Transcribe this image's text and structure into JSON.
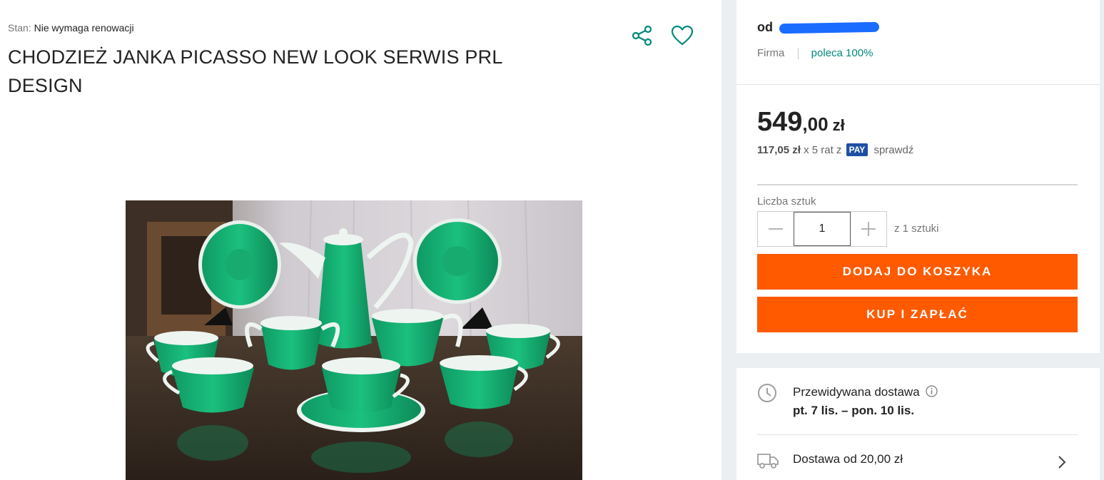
{
  "product": {
    "condition_label": "Stan:",
    "condition_value": "Nie wymaga renowacji",
    "title": "CHODZIEŻ JANKA PICASSO NEW LOOK SERWIS PRL DESIGN",
    "photo_alt": "green porcelain coffee set on table",
    "share_icon": "share-icon",
    "favorite_icon": "heart-icon"
  },
  "seller": {
    "prefix": "od",
    "type": "Firma",
    "recommend": "poleca 100%"
  },
  "pricing": {
    "price_int": "549",
    "price_dec": ",00",
    "currency": "zł",
    "installment_amount": "117,05 zł",
    "installment_text": "x 5 rat z",
    "pay_badge": "PAY",
    "check_link": "sprawdź"
  },
  "quantity": {
    "label": "Liczba sztuk",
    "value": "1",
    "of_text": "z 1 sztuki"
  },
  "actions": {
    "add_to_cart": "DODAJ DO KOSZYKA",
    "buy_now": "KUP I ZAPŁAĆ"
  },
  "delivery": {
    "estimated_title": "Przewidywana dostawa",
    "estimated_dates": "pt. 7 lis. – pon. 10 lis.",
    "cost_text": "Dostawa od 20,00 zł"
  },
  "colors": {
    "accent_teal": "#00897b",
    "action_orange": "#ff5a00",
    "pay_blue": "#1e4fa3"
  }
}
